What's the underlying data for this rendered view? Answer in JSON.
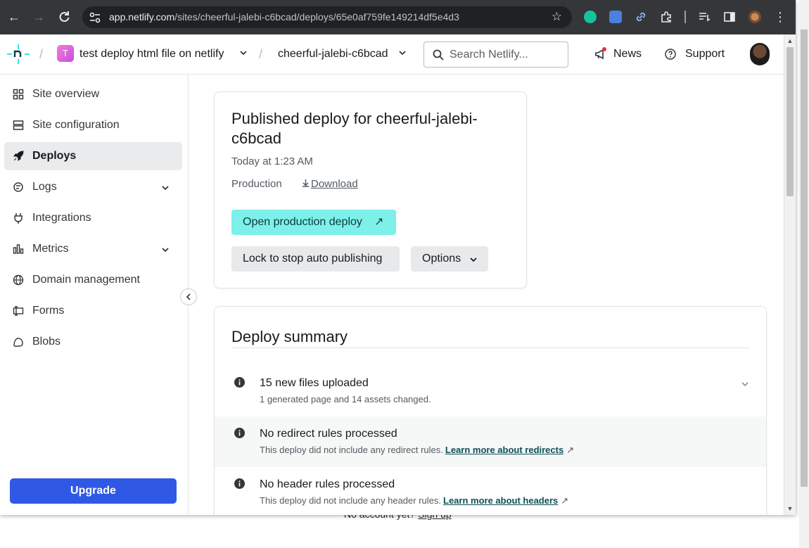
{
  "browser": {
    "url_domain": "app.netlify.com",
    "url_path": "/sites/cheerful-jalebi-c6bcad/deploys/65e0af759fe149214df5e4d3"
  },
  "header": {
    "team_initial": "T",
    "team_name": "test deploy html file on netlify",
    "site_name": "cheerful-jalebi-c6bcad",
    "search_placeholder": "Search Netlify...",
    "news_label": "News",
    "support_label": "Support"
  },
  "sidebar": {
    "items": [
      {
        "label": "Site overview"
      },
      {
        "label": "Site configuration"
      },
      {
        "label": "Deploys"
      },
      {
        "label": "Logs"
      },
      {
        "label": "Integrations"
      },
      {
        "label": "Metrics"
      },
      {
        "label": "Domain management"
      },
      {
        "label": "Forms"
      },
      {
        "label": "Blobs"
      }
    ],
    "upgrade_label": "Upgrade"
  },
  "deploy": {
    "title": "Published deploy for cheerful-jalebi-c6bcad",
    "time": "Today at 1:23 AM",
    "context": "Production",
    "download_label": "Download",
    "open_label": "Open production deploy",
    "lock_label": "Lock to stop auto publishing",
    "options_label": "Options"
  },
  "summary": {
    "title": "Deploy summary",
    "rows": [
      {
        "heading": "15 new files uploaded",
        "detail": "1 generated page and 14 assets changed.",
        "link": ""
      },
      {
        "heading": "No redirect rules processed",
        "detail": "This deploy did not include any redirect rules.",
        "link": "Learn more about redirects"
      },
      {
        "heading": "No header rules processed",
        "detail": "This deploy did not include any header rules.",
        "link": "Learn more about headers"
      }
    ]
  },
  "behind_page": {
    "text": "No account yet?",
    "link": "Sign up"
  },
  "colors": {
    "accent_teal": "#7df0ea",
    "upgrade_blue": "#2f59e4",
    "link_teal": "#0d4f55"
  }
}
